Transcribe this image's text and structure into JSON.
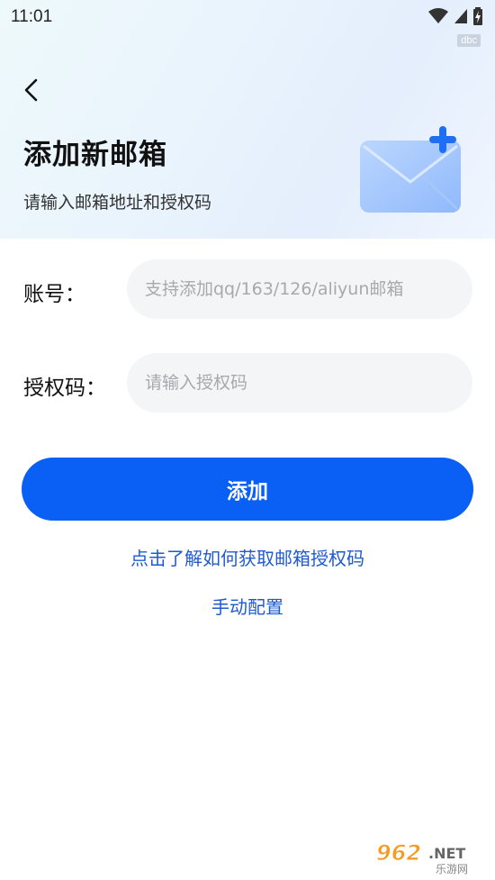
{
  "status_bar": {
    "time": "11:01",
    "tag": "dbc"
  },
  "header": {
    "title": "添加新邮箱",
    "subtitle": "请输入邮箱地址和授权码",
    "illustration": "mail-plus-icon"
  },
  "form": {
    "account_label": "账号：",
    "account_placeholder": "支持添加qq/163/126/aliyun邮箱",
    "auth_label": "授权码：",
    "auth_placeholder": "请输入授权码"
  },
  "actions": {
    "add_label": "添加",
    "help_link": "点击了解如何获取邮箱授权码",
    "manual_link": "手动配置"
  },
  "watermark": {
    "number": "962",
    "suffix": ".NET",
    "sub": "乐游网"
  },
  "colors": {
    "primary": "#0a60f5",
    "link": "#1e5bd0"
  }
}
